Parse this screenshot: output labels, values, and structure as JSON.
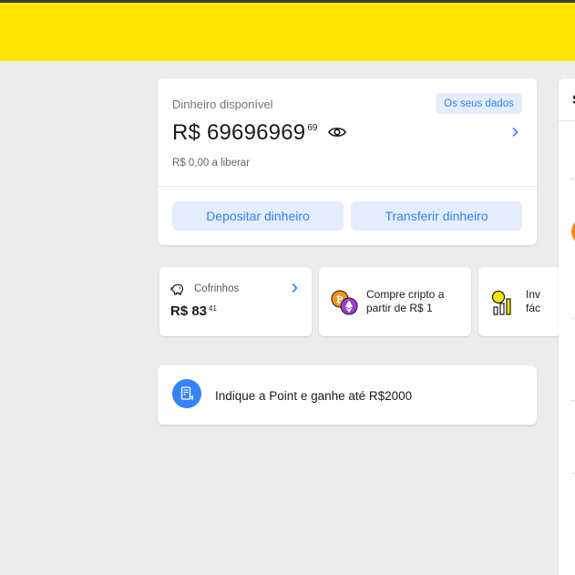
{
  "balance": {
    "label": "Dinheiro disponível",
    "data_button": "Os seus dados",
    "amount": "R$ 69696969",
    "cents": "69",
    "to_release": "R$ 0,00 a liberar",
    "deposit_button": "Depositar dinheiro",
    "transfer_button": "Transferir dinheiro"
  },
  "piggy": {
    "label": "Cofrinhos",
    "amount": "R$ 83",
    "cents": "41"
  },
  "crypto": {
    "line1": "Compre cripto a",
    "line2": "partir de R$ 1"
  },
  "invest": {
    "line1": "Inv",
    "line2": "fác"
  },
  "refer": {
    "text": "Indique a Point e ganhe até R$2000"
  },
  "right_panel": {
    "letter": "S"
  },
  "colors": {
    "header": "#ffe600",
    "accent": "#3483fa",
    "button_bg": "#e3edfb",
    "background": "#ececec"
  }
}
